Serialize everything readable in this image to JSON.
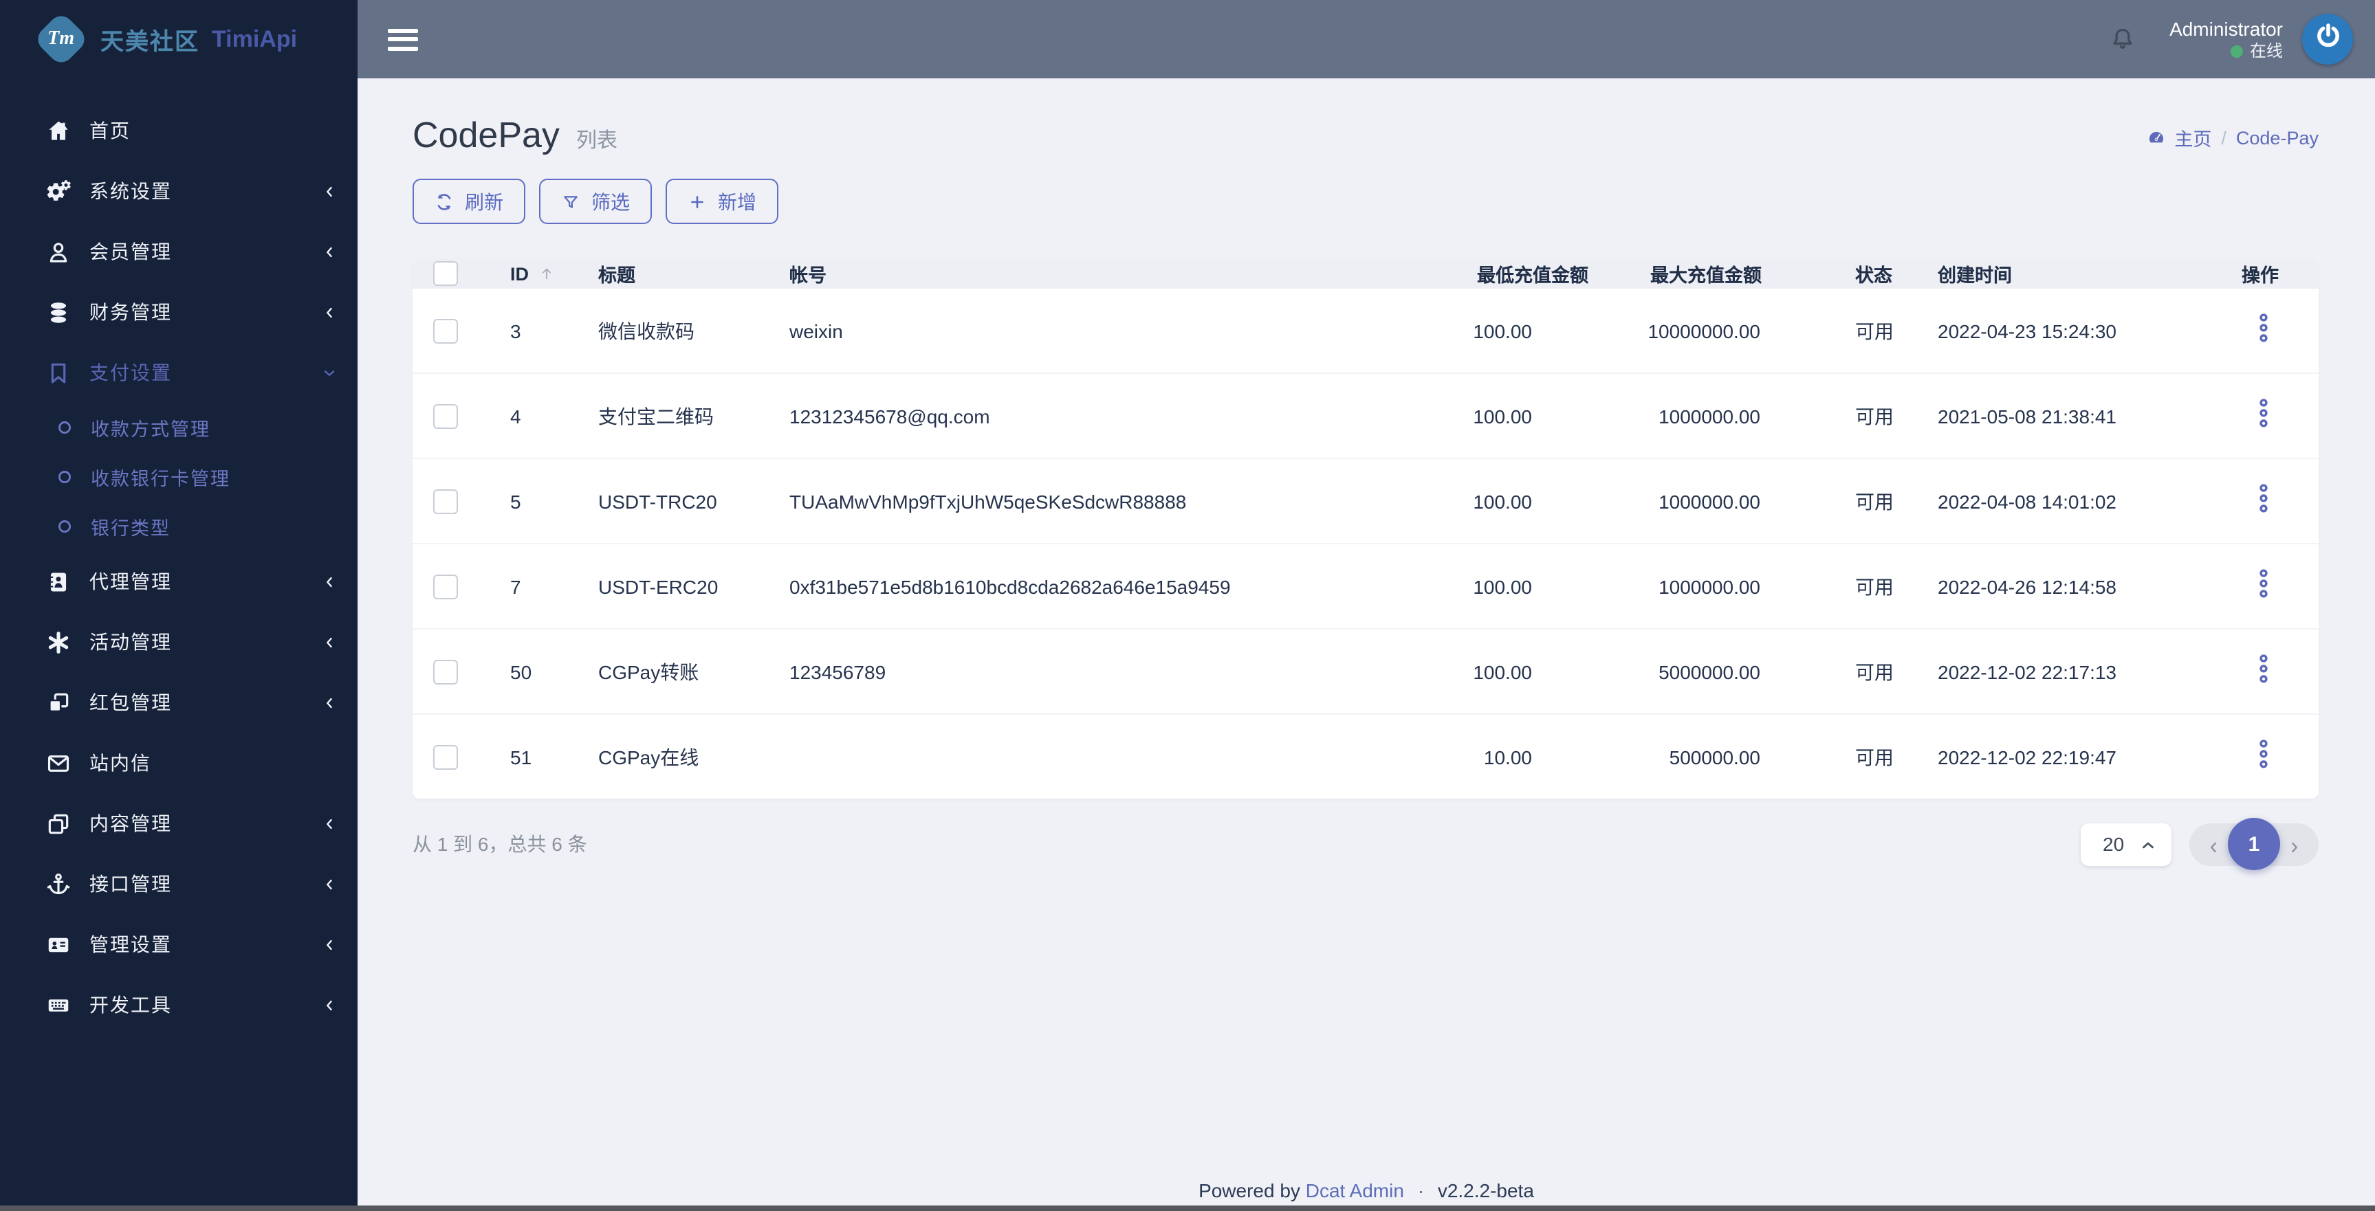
{
  "colors": {
    "accent": "#5c6bc0",
    "sidebar_bg": "#16213a",
    "topbar_bg": "#657187",
    "online_green": "#4eb076",
    "avatar_blue": "#2c7abe",
    "logo_teal": "#4c86ab"
  },
  "sidebar": {
    "logo": {
      "badge": "Tm",
      "community": "天美社区",
      "app": "TimiApi"
    },
    "items": [
      {
        "id": "home",
        "label": "首页",
        "icon": "home-icon",
        "chevron": "none",
        "active": false
      },
      {
        "id": "system-settings",
        "label": "系统设置",
        "icon": "cogs-icon",
        "chevron": "left",
        "active": false
      },
      {
        "id": "member-management",
        "label": "会员管理",
        "icon": "user-icon",
        "chevron": "left",
        "active": false
      },
      {
        "id": "finance-management",
        "label": "财务管理",
        "icon": "database-icon",
        "chevron": "left",
        "active": false
      },
      {
        "id": "payment-settings",
        "label": "支付设置",
        "icon": "bookmark-icon",
        "chevron": "down",
        "active": true,
        "children": [
          {
            "id": "payment-method-management",
            "label": "收款方式管理"
          },
          {
            "id": "receiving-bank-card-management",
            "label": "收款银行卡管理"
          },
          {
            "id": "bank-type",
            "label": "银行类型"
          }
        ]
      },
      {
        "id": "agent-management",
        "label": "代理管理",
        "icon": "address-book-icon",
        "chevron": "left",
        "active": false
      },
      {
        "id": "activity-management",
        "label": "活动管理",
        "icon": "asterisk-icon",
        "chevron": "left",
        "active": false
      },
      {
        "id": "red-packet-management",
        "label": "红包管理",
        "icon": "red-packet-icon",
        "chevron": "left",
        "active": false
      },
      {
        "id": "site-message",
        "label": "站内信",
        "icon": "envelope-icon",
        "chevron": "none",
        "active": false
      },
      {
        "id": "content-management",
        "label": "内容管理",
        "icon": "clone-icon",
        "chevron": "left",
        "active": false
      },
      {
        "id": "api-management",
        "label": "接口管理",
        "icon": "anchor-icon",
        "chevron": "left",
        "active": false
      },
      {
        "id": "admin-settings",
        "label": "管理设置",
        "icon": "id-card-icon",
        "chevron": "left",
        "active": false
      },
      {
        "id": "dev-tools",
        "label": "开发工具",
        "icon": "keyboard-icon",
        "chevron": "left",
        "active": false
      }
    ]
  },
  "topbar": {
    "user": "Administrator",
    "status": "在线"
  },
  "page": {
    "title": "CodePay",
    "subtitle": "列表",
    "breadcrumb": {
      "home": "主页",
      "current": "Code-Pay"
    }
  },
  "toolbar": {
    "refresh": "刷新",
    "filter": "筛选",
    "create": "新增"
  },
  "table": {
    "headers": [
      "ID",
      "标题",
      "帐号",
      "最低充值金额",
      "最大充值金额",
      "状态",
      "创建时间",
      "操作"
    ],
    "rows": [
      {
        "id": "3",
        "title": "微信收款码",
        "account": "weixin",
        "min": "100.00",
        "max": "10000000.00",
        "status": "可用",
        "created": "2022-04-23 15:24:30"
      },
      {
        "id": "4",
        "title": "支付宝二维码",
        "account": "12312345678@qq.com",
        "min": "100.00",
        "max": "1000000.00",
        "status": "可用",
        "created": "2021-05-08 21:38:41"
      },
      {
        "id": "5",
        "title": "USDT-TRC20",
        "account": "TUAaMwVhMp9fTxjUhW5qeSKeSdcwR88888",
        "min": "100.00",
        "max": "1000000.00",
        "status": "可用",
        "created": "2022-04-08 14:01:02"
      },
      {
        "id": "7",
        "title": "USDT-ERC20",
        "account": "0xf31be571e5d8b1610bcd8cda2682a646e15a9459",
        "min": "100.00",
        "max": "1000000.00",
        "status": "可用",
        "created": "2022-04-26 12:14:58"
      },
      {
        "id": "50",
        "title": "CGPay转账",
        "account": "123456789",
        "min": "100.00",
        "max": "5000000.00",
        "status": "可用",
        "created": "2022-12-02 22:17:13"
      },
      {
        "id": "51",
        "title": "CGPay在线",
        "account": "",
        "min": "10.00",
        "max": "500000.00",
        "status": "可用",
        "created": "2022-12-02 22:19:47"
      }
    ]
  },
  "pagination": {
    "summary": "从 1 到 6，总共 6 条",
    "per_page": "20",
    "current_page": "1"
  },
  "footer": {
    "powered": "Powered by",
    "link": "Dcat Admin",
    "separator": "·",
    "version": "v2.2.2-beta"
  }
}
